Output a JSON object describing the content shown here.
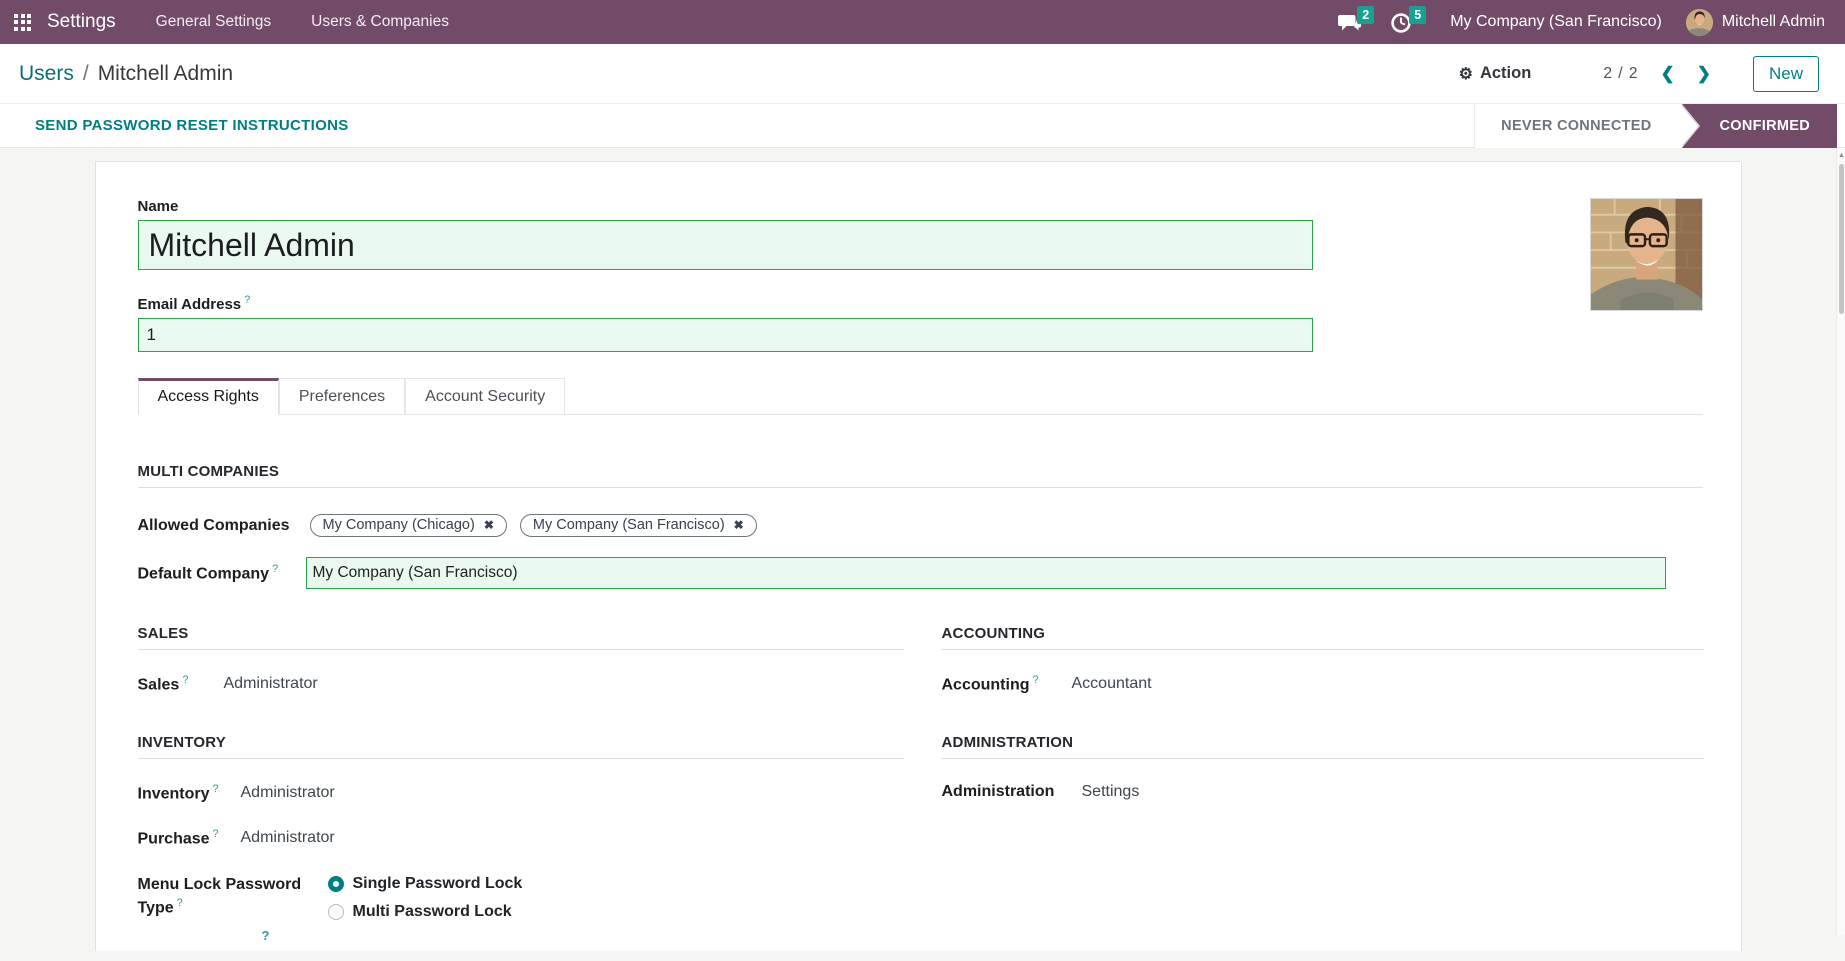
{
  "icons": {
    "gear": "⚙",
    "chevron_left": "❮",
    "chevron_right": "❯",
    "close": "✖",
    "help": "?",
    "scroll_up": "▲",
    "separator": "/"
  },
  "colors": {
    "navbar_bg": "#714B67",
    "accent": "#017E84",
    "badge": "#17A193",
    "highlight_bg": "#E9F9EF",
    "highlight_border": "#28A745",
    "status_active_bg": "#714B67"
  },
  "navbar": {
    "app_name": "Settings",
    "menu_items": [
      "General Settings",
      "Users & Companies"
    ],
    "messages_badge": "2",
    "activities_badge": "5",
    "company": "My Company (San Francisco)",
    "user": "Mitchell Admin"
  },
  "control_panel": {
    "breadcrumb_parent": "Users",
    "breadcrumb_current": "Mitchell Admin",
    "action_label": "Action",
    "pager": "2 / 2",
    "new_button": "New"
  },
  "status_bar": {
    "action_button": "SEND PASSWORD RESET INSTRUCTIONS",
    "steps": [
      {
        "label": "NEVER CONNECTED",
        "active": false
      },
      {
        "label": "CONFIRMED",
        "active": true
      }
    ]
  },
  "form": {
    "name_label": "Name",
    "name_value": "Mitchell Admin",
    "email_label": "Email Address",
    "email_value": "1",
    "tabs": [
      {
        "label": "Access Rights",
        "active": true
      },
      {
        "label": "Preferences",
        "active": false
      },
      {
        "label": "Account Security",
        "active": false
      }
    ],
    "multi_companies": {
      "title": "MULTI COMPANIES",
      "allowed_label": "Allowed Companies",
      "tags": [
        "My Company (Chicago)",
        "My Company (San Francisco)"
      ],
      "default_label": "Default Company",
      "default_value": "My Company (San Francisco)"
    },
    "sales": {
      "title": "SALES",
      "label": "Sales",
      "value": "Administrator"
    },
    "accounting": {
      "title": "ACCOUNTING",
      "label": "Accounting",
      "value": "Accountant"
    },
    "inventory": {
      "title": "INVENTORY",
      "rows": [
        {
          "label": "Inventory",
          "value": "Administrator"
        },
        {
          "label": "Purchase",
          "value": "Administrator"
        }
      ],
      "menu_lock_label": "Menu Lock Password Type",
      "options": [
        {
          "label": "Single Password Lock",
          "selected": true
        },
        {
          "label": "Multi Password Lock",
          "selected": false
        }
      ]
    },
    "administration": {
      "title": "ADMINISTRATION",
      "label": "Administration",
      "value": "Settings"
    }
  }
}
